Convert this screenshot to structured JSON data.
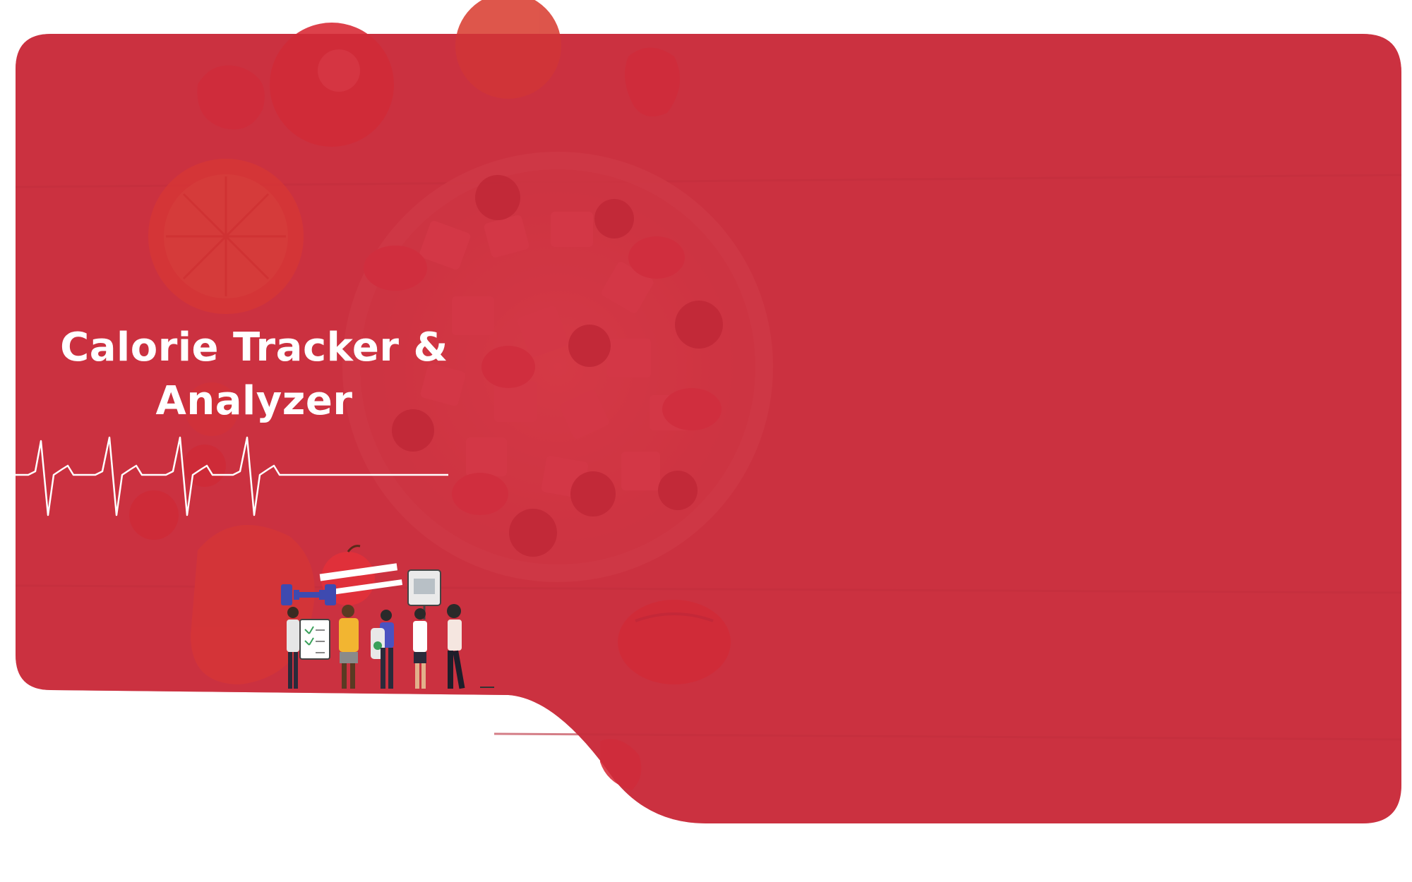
{
  "hero": {
    "title_line1": "Calorie Tracker &",
    "title_line2": "Analyzer",
    "background_theme": "fruit-salad-bowl-photo",
    "illustration": "fitness-people-with-apple-dumbbell-scale"
  },
  "colors": {
    "brand_red": "#c9303f",
    "overlay_red": "#cc3341",
    "accent_fruit": "#e0303a",
    "heartbeat_line": "#ffffff",
    "background": "#ffffff"
  }
}
